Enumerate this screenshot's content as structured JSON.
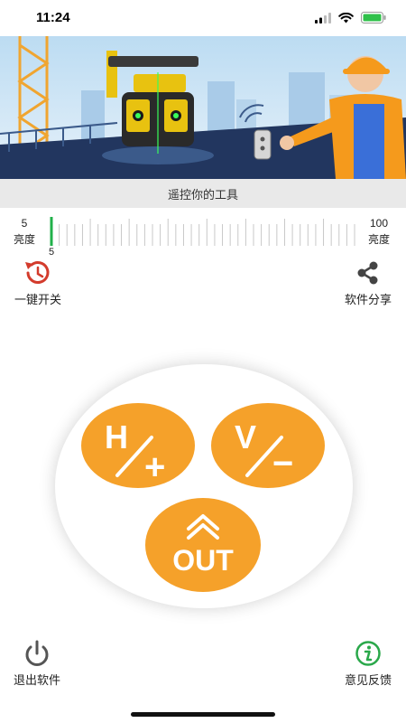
{
  "status": {
    "time": "11:24"
  },
  "banner": {
    "caption": "遥控你的工具"
  },
  "brightness": {
    "min_value": "5",
    "min_label": "亮度",
    "max_value": "100",
    "max_label": "亮度",
    "current_value": "5",
    "level_fraction": 0.0,
    "accent": "#21b04a"
  },
  "features": {
    "power_toggle": "一键开关",
    "share": "软件分享",
    "exit": "退出软件",
    "feedback": "意见反馈"
  },
  "controls": {
    "h_button": {
      "letter": "H",
      "sign": "+"
    },
    "v_button": {
      "letter": "V",
      "sign": "−"
    },
    "out_button": {
      "label": "OUT"
    },
    "color": "#f5a12a"
  }
}
